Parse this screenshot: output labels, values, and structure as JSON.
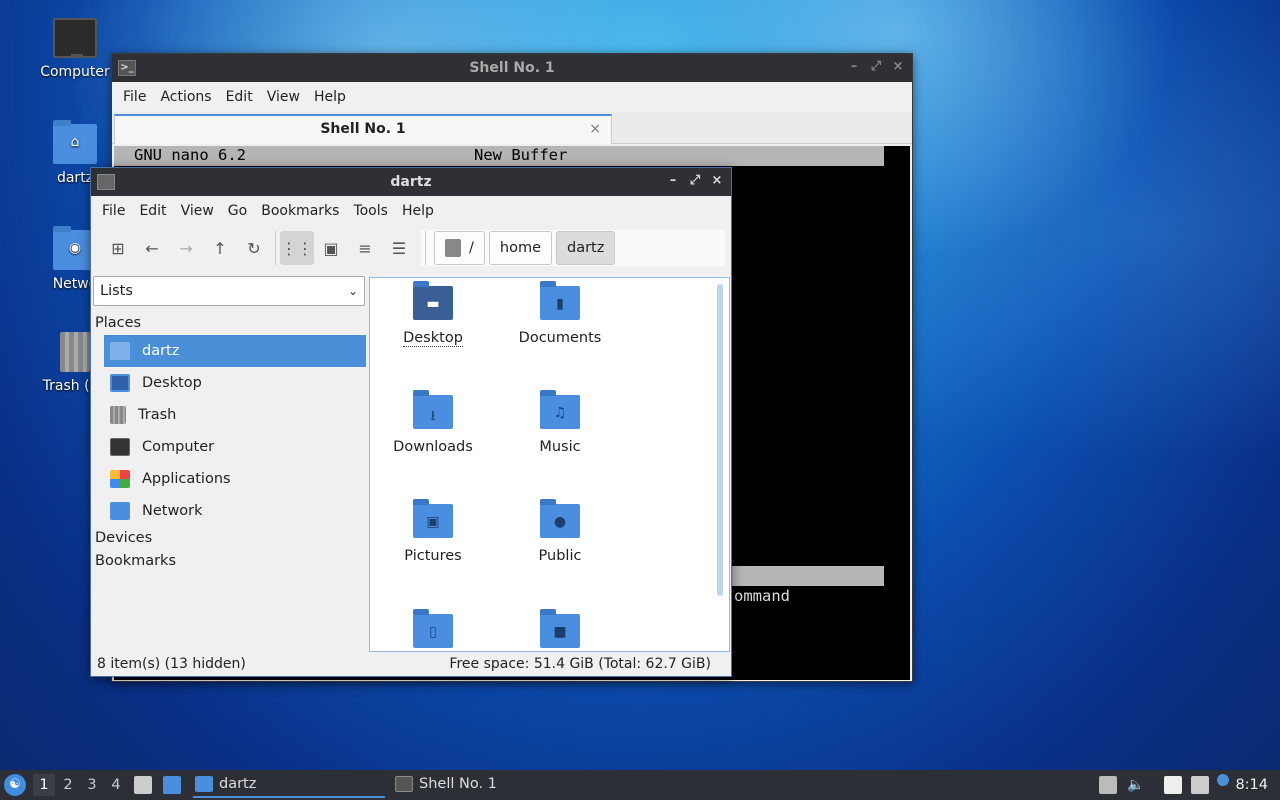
{
  "desktop": {
    "icons": [
      {
        "label": "Computer"
      },
      {
        "label": "dartz"
      },
      {
        "label": "Netwo"
      },
      {
        "label": "Trash (En"
      }
    ]
  },
  "terminal": {
    "title": "Shell No. 1",
    "menu": [
      "File",
      "Actions",
      "Edit",
      "View",
      "Help"
    ],
    "tab_label": "Shell No. 1",
    "tab_close": "×",
    "nano_header_left": "GNU nano 6.2",
    "nano_header_center": "New Buffer",
    "visible_text": "ommand"
  },
  "file_manager": {
    "title": "dartz",
    "menu": [
      "File",
      "Edit",
      "View",
      "Go",
      "Bookmarks",
      "Tools",
      "Help"
    ],
    "path": [
      "/",
      "home",
      "dartz"
    ],
    "side_combo": "Lists",
    "sections": {
      "places": "Places",
      "devices": "Devices",
      "bookmarks": "Bookmarks"
    },
    "places": [
      {
        "label": "dartz",
        "icon": "home-folder-icon",
        "selected": true
      },
      {
        "label": "Desktop",
        "icon": "desktop-icon"
      },
      {
        "label": "Trash",
        "icon": "trash-icon"
      },
      {
        "label": "Computer",
        "icon": "computer-icon"
      },
      {
        "label": "Applications",
        "icon": "applications-icon"
      },
      {
        "label": "Network",
        "icon": "network-icon"
      }
    ],
    "items": [
      {
        "label": "Desktop",
        "icon": "desktop-folder-icon"
      },
      {
        "label": "Documents",
        "icon": "documents-folder-icon"
      },
      {
        "label": "Downloads",
        "icon": "downloads-folder-icon"
      },
      {
        "label": "Music",
        "icon": "music-folder-icon"
      },
      {
        "label": "Pictures",
        "icon": "pictures-folder-icon"
      },
      {
        "label": "Public",
        "icon": "public-folder-icon"
      },
      {
        "label": "",
        "icon": "templates-folder-icon"
      },
      {
        "label": "",
        "icon": "videos-folder-icon"
      }
    ],
    "status_left": "8 item(s) (13 hidden)",
    "status_right": "Free space: 51.4 GiB (Total: 62.7 GiB)"
  },
  "taskbar": {
    "workspaces": [
      "1",
      "2",
      "3",
      "4"
    ],
    "tasks": [
      {
        "label": "dartz",
        "active": true
      },
      {
        "label": "Shell No. 1",
        "active": false
      }
    ],
    "clock": "8:14"
  },
  "colors": {
    "accent": "#4a90d9",
    "folder": "#4a8ee0",
    "titlebar": "#2f3036",
    "taskbar": "#2c2f36"
  }
}
